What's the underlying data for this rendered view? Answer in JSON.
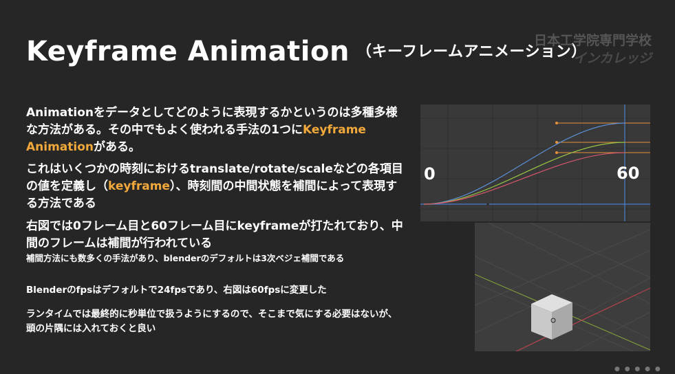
{
  "slide": {
    "title": "Keyframe Animation",
    "title_sub": "（キーフレームアニメーション）",
    "logo_line1": "日本工学院専門学校",
    "logo_line2": "インカレッジ"
  },
  "content": {
    "p1_a": "Animationをデータとしてどのように表現するかというのは多種多様な方法がある。その中でもよく使われる手法の1つに",
    "p1_accent": "Keyframe Animation",
    "p1_b": "がある。",
    "p2_a": "これはいくつかの時刻におけるtranslate/rotate/scaleなどの各項目の値を定義し（",
    "p2_accent": "keyframe",
    "p2_b": "）、時刻間の中間状態を補間によって表現する方法である",
    "p3": "右図では0フレーム目と60フレーム目にkeyframeが打たれており、中間のフレームは補間が行われている",
    "p3_note": "補間方法にも数多くの手法があり、blenderのデフォルトは3次ベジェ補間である",
    "p4": "Blenderのfpsはデフォルトで24fpsであり、右図は60fpsに変更した",
    "p5": "ランタイムでは最終的に秒単位で扱うようにするので、そこまで気にする必要はないが、頭の片隅には入れておくと良い"
  },
  "graph": {
    "label_start": "0",
    "label_end": "60",
    "curve_colors": [
      "#5b8fd6",
      "#9bc843",
      "#d8576b"
    ],
    "handle_color": "#e6913c",
    "cursor_color": "#4a7fd0"
  },
  "viewport": {
    "cube_color": "#cfcfcf",
    "x_axis_color": "#b2424d",
    "y_axis_color": "#7f9b3a"
  }
}
